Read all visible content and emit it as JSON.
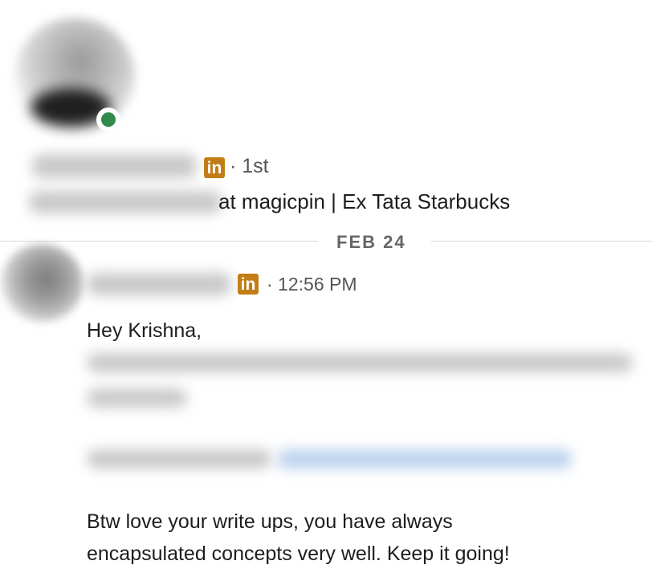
{
  "profile": {
    "degree": "· 1st",
    "headline_visible": "at magicpin | Ex Tata Starbucks",
    "badge_letters": "in"
  },
  "divider": {
    "date": "FEB 24"
  },
  "message": {
    "badge_letters": "in",
    "time": "· 12:56 PM",
    "greeting": "Hey Krishna,",
    "closing_line1": "Btw love your write ups, you have always",
    "closing_line2": "encapsulated concepts very well. Keep it going!"
  },
  "colors": {
    "linkedin_badge": "#c37d16",
    "presence_green": "#2f8a4b",
    "divider": "#d9d9d9"
  },
  "icons": [
    "linkedin-premium-icon",
    "online-presence-icon"
  ]
}
